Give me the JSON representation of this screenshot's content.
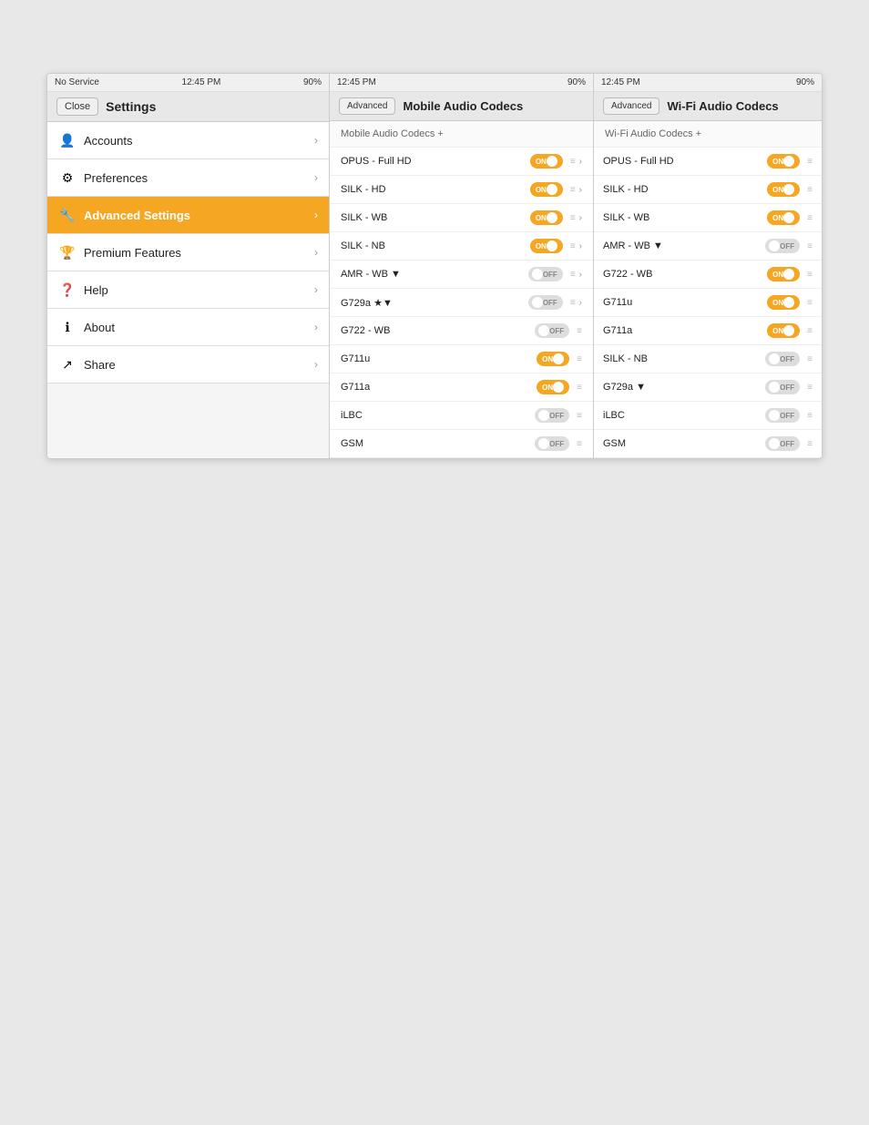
{
  "settings": {
    "status_bar": {
      "signal": "No Service",
      "time": "12:45 PM",
      "battery": "90%"
    },
    "nav": {
      "close_label": "Close",
      "title": "Settings"
    },
    "menu_items": [
      {
        "id": "accounts",
        "label": "Accounts",
        "icon": "👤",
        "active": false
      },
      {
        "id": "preferences",
        "label": "Preferences",
        "icon": "⚙",
        "active": false
      },
      {
        "id": "advanced",
        "label": "Advanced Settings",
        "icon": "🔧",
        "active": true
      },
      {
        "id": "premium",
        "label": "Premium Features",
        "icon": "🏆",
        "active": false
      },
      {
        "id": "help",
        "label": "Help",
        "icon": "❓",
        "active": false
      },
      {
        "id": "about",
        "label": "About",
        "icon": "ℹ",
        "active": false
      },
      {
        "id": "share",
        "label": "Share",
        "icon": "↗",
        "active": false
      }
    ]
  },
  "mobile_codecs": {
    "status_bar": {
      "time": "12:45 PM",
      "battery": "90%"
    },
    "nav": {
      "advanced_label": "Advanced",
      "title": "Mobile Audio Codecs"
    },
    "header": "Mobile Audio Codecs +",
    "codecs": [
      {
        "name": "OPUS - Full HD",
        "state": "ON",
        "on": true
      },
      {
        "name": "SILK - HD",
        "state": "ON",
        "on": true
      },
      {
        "name": "SILK - WB",
        "state": "ON",
        "on": true
      },
      {
        "name": "SILK - NB",
        "state": "ON",
        "on": true
      },
      {
        "name": "AMR - WB ▼",
        "state": "OFF",
        "on": false
      },
      {
        "name": "G729a ★▼",
        "state": "OFF",
        "on": false
      },
      {
        "name": "G722 - WB",
        "state": "OFF",
        "on": false
      },
      {
        "name": "G711u",
        "state": "ON",
        "on": true
      },
      {
        "name": "G711a",
        "state": "ON",
        "on": true
      },
      {
        "name": "iLBC",
        "state": "OFF",
        "on": false
      },
      {
        "name": "GSM",
        "state": "OFF",
        "on": false
      }
    ]
  },
  "wifi_codecs": {
    "status_bar": {
      "time": "12:45 PM",
      "battery": "90%"
    },
    "nav": {
      "advanced_label": "Advanced",
      "title": "Wi-Fi Audio Codecs"
    },
    "header": "Wi-Fi Audio Codecs +",
    "codecs": [
      {
        "name": "OPUS - Full HD",
        "state": "ON",
        "on": true
      },
      {
        "name": "SILK - HD",
        "state": "ON",
        "on": true
      },
      {
        "name": "SILK - WB",
        "state": "ON",
        "on": true
      },
      {
        "name": "AMR - WB ▼",
        "state": "OFF",
        "on": false
      },
      {
        "name": "G722 - WB",
        "state": "ON",
        "on": true
      },
      {
        "name": "G711u",
        "state": "ON",
        "on": true
      },
      {
        "name": "G711a",
        "state": "ON",
        "on": true
      },
      {
        "name": "SILK - NB",
        "state": "OFF",
        "on": false
      },
      {
        "name": "G729a ▼",
        "state": "OFF",
        "on": false
      },
      {
        "name": "iLBC",
        "state": "OFF",
        "on": false
      },
      {
        "name": "GSM",
        "state": "OFF",
        "on": false
      }
    ]
  }
}
